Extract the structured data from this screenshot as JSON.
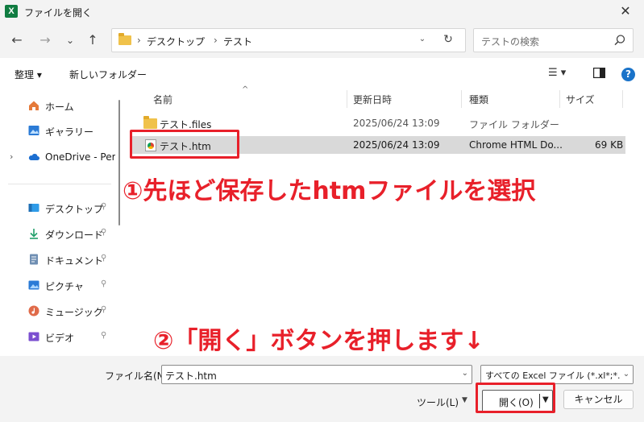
{
  "window": {
    "title": "ファイルを開く",
    "app_icon_letter": "X",
    "close_glyph": "✕"
  },
  "nav": {
    "back": "←",
    "forward": "→",
    "recent": "⌄",
    "up": "↑"
  },
  "address": {
    "sep": "›",
    "crumbs": [
      "デスクトップ",
      "テスト"
    ],
    "dropdown": "⌄",
    "refresh": "↻"
  },
  "search": {
    "placeholder": "テストの検索"
  },
  "toolbar": {
    "organize": "整理 ▾",
    "new_folder": "新しいフォルダー",
    "view_menu": "☰ ▾",
    "help": "?"
  },
  "sidebar": {
    "items": [
      {
        "label": "ホーム",
        "icon": "home-icon"
      },
      {
        "label": "ギャラリー",
        "icon": "gallery-icon"
      },
      {
        "label": "OneDrive - Perso",
        "icon": "cloud-icon",
        "expand": "›"
      },
      {
        "label": "デスクトップ",
        "icon": "desktop-icon",
        "pin": "📌"
      },
      {
        "label": "ダウンロード",
        "icon": "download-icon",
        "pin": "📌"
      },
      {
        "label": "ドキュメント",
        "icon": "document-icon",
        "pin": "📌"
      },
      {
        "label": "ピクチャ",
        "icon": "pictures-icon",
        "pin": "📌"
      },
      {
        "label": "ミュージック",
        "icon": "music-icon",
        "pin": "📌"
      },
      {
        "label": "ビデオ",
        "icon": "video-icon",
        "pin": "📌"
      }
    ]
  },
  "columns": {
    "name": "名前",
    "modified": "更新日時",
    "type": "種類",
    "size": "サイズ",
    "sort_caret": "^"
  },
  "files": [
    {
      "name": "テスト.files",
      "modified": "2025/06/24 13:09",
      "type": "ファイル フォルダー",
      "size": "",
      "icon": "folder-icon"
    },
    {
      "name": "テスト.htm",
      "modified": "2025/06/24 13:09",
      "type": "Chrome HTML Do...",
      "size": "69 KB",
      "icon": "chrome-html-icon"
    }
  ],
  "annotations": {
    "step1": "①先ほど保存したhtmファイルを選択",
    "step2": "②「開く」ボタンを押します↓",
    "highlight_color": "#e8202a"
  },
  "bottom": {
    "filename_label": "ファイル名(N):",
    "filename_value": "テスト.htm",
    "filter_value": "すべての Excel ファイル (*.xl*;*.xlsx",
    "tools_label": "ツール(L)",
    "open_label": "開く(O)",
    "cancel_label": "キャンセル"
  }
}
